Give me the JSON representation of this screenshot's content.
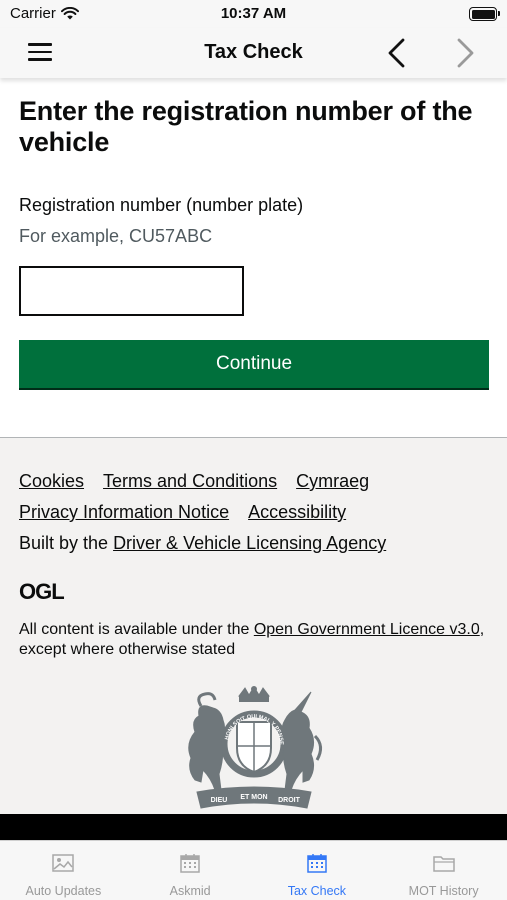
{
  "status_bar": {
    "carrier": "Carrier",
    "time": "10:37 AM"
  },
  "nav": {
    "title": "Tax Check",
    "menu_icon": "hamburger-icon",
    "back_icon": "chevron-left-icon",
    "forward_icon": "chevron-right-icon"
  },
  "main": {
    "heading": "Enter the registration number of the vehicle",
    "field_label": "Registration number (number plate)",
    "field_hint": "For example, CU57ABC",
    "input_value": "",
    "continue_label": "Continue"
  },
  "footer": {
    "links_row1": [
      "Cookies",
      "Terms and Conditions",
      "Cymraeg"
    ],
    "links_row2": [
      "Privacy Information Notice",
      "Accessibility"
    ],
    "built_by_prefix": "Built by the ",
    "built_by_link": "Driver & Vehicle Licensing Agency",
    "ogl_logo_text": "OGL",
    "licence_prefix": "All content is available under the ",
    "licence_link": "Open Government Licence v3.0",
    "licence_suffix": ", except where otherwise stated",
    "crest_icon": "royal-coat-of-arms-icon",
    "crest_text": [
      "DIEU",
      "ET MON",
      "DROIT",
      "HONI SOIT QUI MAL Y PENSE"
    ]
  },
  "tabs": [
    {
      "label": "Auto  Updates",
      "icon": "image-icon",
      "active": false
    },
    {
      "label": "Askmid",
      "icon": "calendar-icon",
      "active": false
    },
    {
      "label": "Tax Check",
      "icon": "calendar-icon",
      "active": true
    },
    {
      "label": "MOT History",
      "icon": "folder-icon",
      "active": false
    }
  ],
  "colors": {
    "accent": "#3478f6",
    "button_green": "#00703c",
    "footer_bg": "#f3f2f1",
    "text": "#0b0c0c",
    "hint": "#505a5f"
  }
}
